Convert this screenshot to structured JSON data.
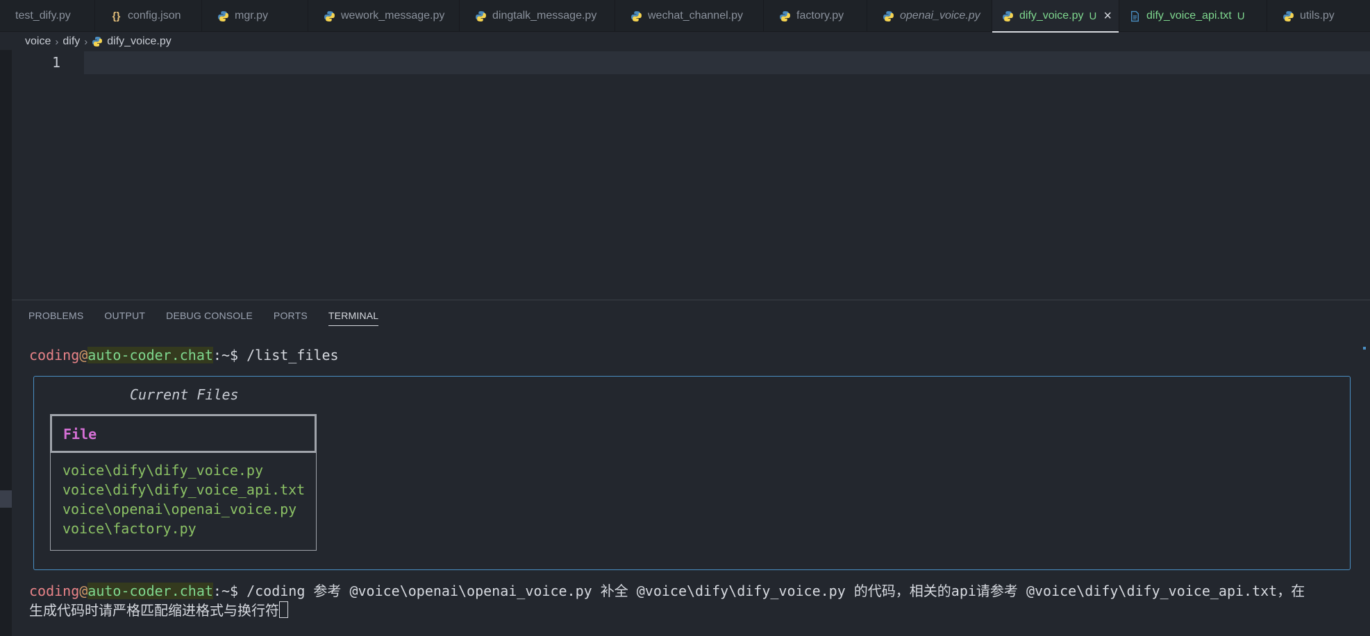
{
  "tabs": [
    {
      "label": "test_dify.py",
      "icon": "none",
      "state": "normal"
    },
    {
      "label": "config.json",
      "icon": "json-icon",
      "state": "normal"
    },
    {
      "label": "mgr.py",
      "icon": "python-icon",
      "state": "normal"
    },
    {
      "label": "wework_message.py",
      "icon": "python-icon",
      "state": "normal"
    },
    {
      "label": "dingtalk_message.py",
      "icon": "python-icon",
      "state": "normal"
    },
    {
      "label": "wechat_channel.py",
      "icon": "python-icon",
      "state": "normal"
    },
    {
      "label": "factory.py",
      "icon": "python-icon",
      "state": "normal"
    },
    {
      "label": "openai_voice.py",
      "icon": "python-icon",
      "state": "italic"
    },
    {
      "label": "dify_voice.py",
      "icon": "python-icon",
      "state": "active",
      "badge": "U"
    },
    {
      "label": "dify_voice_api.txt",
      "icon": "file-icon",
      "state": "green",
      "badge": "U"
    },
    {
      "label": "utils.py",
      "icon": "python-icon",
      "state": "normal"
    }
  ],
  "breadcrumb": {
    "parts": [
      "voice",
      "dify",
      "dify_voice.py"
    ]
  },
  "editor": {
    "line_number": "1"
  },
  "panel": {
    "tabs": [
      "PROBLEMS",
      "OUTPUT",
      "DEBUG CONSOLE",
      "PORTS",
      "TERMINAL"
    ],
    "active_tab": "TERMINAL"
  },
  "terminal": {
    "prompt_user": "coding",
    "prompt_at": "@",
    "prompt_host": "auto-coder.chat",
    "prompt_path": ":~$ ",
    "command1": "/list_files",
    "files_title": "Current Files",
    "files_header": "File",
    "files": [
      "voice\\dify\\dify_voice.py",
      "voice\\dify\\dify_voice_api.txt",
      "voice\\openai\\openai_voice.py",
      "voice\\factory.py"
    ],
    "command2_line1": "/coding 参考 @voice\\openai\\openai_voice.py 补全 @voice\\dify\\dify_voice.py 的代码，相关的api请参考 @voice\\dify\\dify_voice_api.txt，在",
    "command2_line2": "生成代码时请严格匹配缩进格式与换行符"
  },
  "colors": {
    "accent_green": "#7fd88f",
    "header_magenta": "#d670d6",
    "file_green": "#8cc265",
    "box_border": "#4a8fc4"
  }
}
